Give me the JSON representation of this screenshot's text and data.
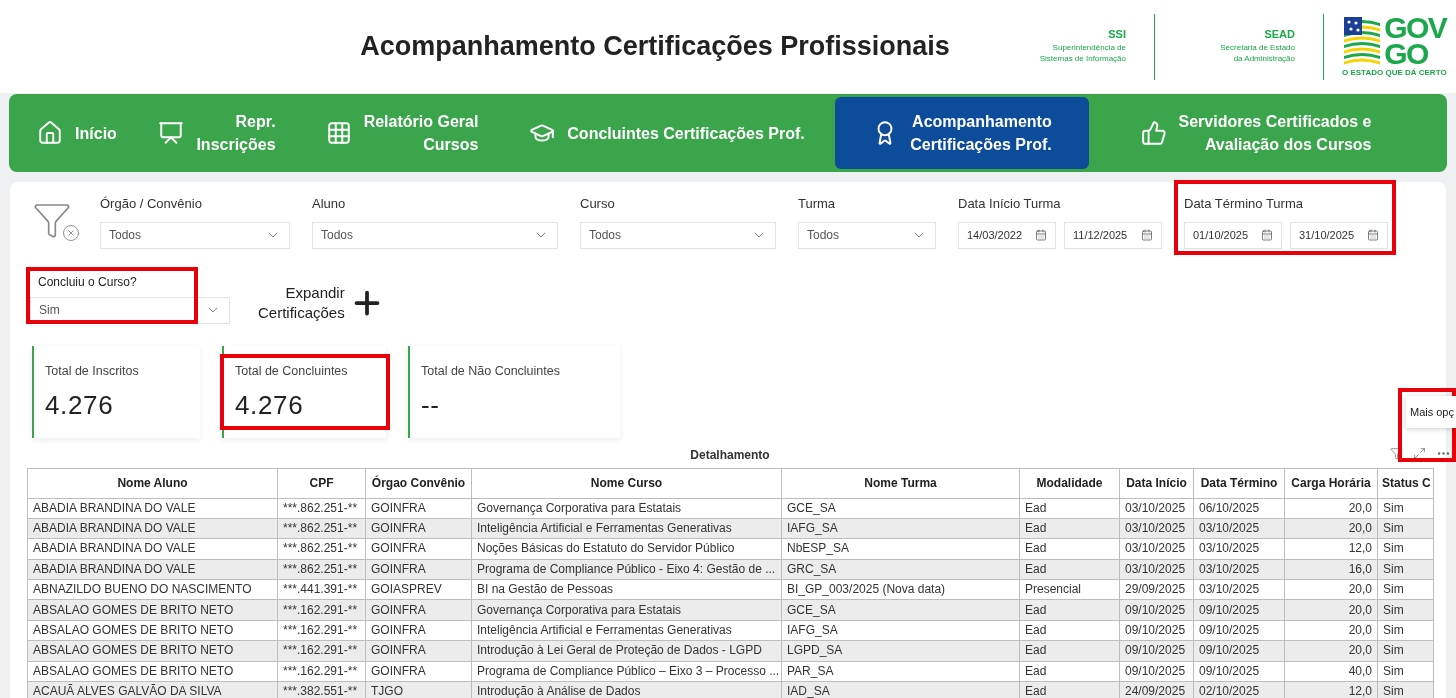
{
  "header": {
    "title": "Acompanhamento Certificações Profissionais",
    "orgs": [
      {
        "acronym": "SSI",
        "name_lines": [
          "Superintendência de",
          "Sistemas de Informação"
        ]
      },
      {
        "acronym": "SEAD",
        "name_lines": [
          "Secretaria de Estado",
          "da Administração"
        ]
      }
    ],
    "logo": {
      "top": "GOV",
      "bottom": "GO",
      "slogan": "O ESTADO QUE DÁ CERTO"
    }
  },
  "nav": [
    {
      "label_lines": [
        "Início"
      ],
      "selected": false
    },
    {
      "label_lines": [
        "Repr.",
        "Inscrições"
      ],
      "selected": false
    },
    {
      "label_lines": [
        "Relatório Geral",
        "Cursos"
      ],
      "selected": false
    },
    {
      "label_lines": [
        "Concluintes Certificações Prof."
      ],
      "selected": false
    },
    {
      "label_lines": [
        "Acompanhamento",
        "Certificações Prof."
      ],
      "selected": true
    },
    {
      "label_lines": [
        "Servidores Certificados e",
        "Avaliação dos Cursos"
      ],
      "selected": false
    }
  ],
  "filters": [
    {
      "kind": "dropdown",
      "label": "Órgão / Convênio",
      "value": "Todos",
      "highlighted": false
    },
    {
      "kind": "dropdown",
      "label": "Aluno",
      "value": "Todos",
      "highlighted": false
    },
    {
      "kind": "dropdown",
      "label": "Curso",
      "value": "Todos",
      "highlighted": false
    },
    {
      "kind": "dropdown",
      "label": "Turma",
      "value": "Todos",
      "highlighted": false
    },
    {
      "kind": "daterange",
      "label": "Data Início Turma",
      "from": "14/03/2022",
      "to": "11/12/2025",
      "highlighted": false
    },
    {
      "kind": "daterange",
      "label": "Data Término Turma",
      "from": "01/10/2025",
      "to": "31/10/2025",
      "highlighted": true
    }
  ],
  "completion_filter": {
    "label": "Concluiu o Curso?",
    "value": "Sim",
    "highlighted": true
  },
  "expand_button": {
    "label_lines": [
      "Expandir",
      "Certificações"
    ]
  },
  "kpis": [
    {
      "label": "Total de Inscritos",
      "value": "4.276",
      "highlighted": false
    },
    {
      "label": "Total de Concluintes",
      "value": "4.276",
      "highlighted": true
    },
    {
      "label": "Total de Não Concluintes",
      "value": "--",
      "highlighted": false
    }
  ],
  "table": {
    "title": "Detalhamento",
    "tooltip": "Mais opç",
    "more_highlighted": true,
    "columns": [
      "Nome Aluno",
      "CPF",
      "Órgao Convênio",
      "Nome Curso",
      "Nome Turma",
      "Modalidade",
      "Data Início",
      "Data Término",
      "Carga Horária",
      "Status C"
    ],
    "rows": [
      [
        "ABADIA BRANDINA DO VALE",
        "***.862.251-**",
        "GOINFRA",
        "Governança Corporativa para Estatais",
        "GCE_SA",
        "Ead",
        "03/10/2025",
        "06/10/2025",
        "20,0",
        "Sim"
      ],
      [
        "ABADIA BRANDINA DO VALE",
        "***.862.251-**",
        "GOINFRA",
        "Inteligência Artificial e Ferramentas Generativas",
        "IAFG_SA",
        "Ead",
        "03/10/2025",
        "03/10/2025",
        "20,0",
        "Sim"
      ],
      [
        "ABADIA BRANDINA DO VALE",
        "***.862.251-**",
        "GOINFRA",
        "Noções Básicas do Estatuto do Servidor Público",
        "NbESP_SA",
        "Ead",
        "03/10/2025",
        "03/10/2025",
        "12,0",
        "Sim"
      ],
      [
        "ABADIA BRANDINA DO VALE",
        "***.862.251-**",
        "GOINFRA",
        "Programa de Compliance Público - Eixo 4: Gestão de ...",
        "GRC_SA",
        "Ead",
        "03/10/2025",
        "03/10/2025",
        "16,0",
        "Sim"
      ],
      [
        "ABNAZILDO BUENO DO NASCIMENTO",
        "***.441.391-**",
        "GOIASPREV",
        "BI na Gestão de Pessoas",
        "BI_GP_003/2025 (Nova data)",
        "Presencial",
        "29/09/2025",
        "03/10/2025",
        "20,0",
        "Sim"
      ],
      [
        "ABSALAO GOMES DE BRITO NETO",
        "***.162.291-**",
        "GOINFRA",
        "Governança Corporativa para Estatais",
        "GCE_SA",
        "Ead",
        "09/10/2025",
        "09/10/2025",
        "20,0",
        "Sim"
      ],
      [
        "ABSALAO GOMES DE BRITO NETO",
        "***.162.291-**",
        "GOINFRA",
        "Inteligência Artificial e Ferramentas Generativas",
        "IAFG_SA",
        "Ead",
        "09/10/2025",
        "09/10/2025",
        "20,0",
        "Sim"
      ],
      [
        "ABSALAO GOMES DE BRITO NETO",
        "***.162.291-**",
        "GOINFRA",
        "Introdução à Lei Geral de Proteção de Dados - LGPD",
        "LGPD_SA",
        "Ead",
        "09/10/2025",
        "09/10/2025",
        "20,0",
        "Sim"
      ],
      [
        "ABSALAO GOMES DE BRITO NETO",
        "***.162.291-**",
        "GOINFRA",
        "Programa de Compliance Público – Eixo 3 – Processo ...",
        "PAR_SA",
        "Ead",
        "09/10/2025",
        "09/10/2025",
        "40,0",
        "Sim"
      ],
      [
        "ACAUÃ ALVES GALVÃO DA SILVA",
        "***.382.551-**",
        "TJGO",
        "Introdução à Análise de Dados",
        "IAD_SA",
        "Ead",
        "24/09/2025",
        "02/10/2025",
        "12,0",
        "Sim"
      ]
    ]
  }
}
